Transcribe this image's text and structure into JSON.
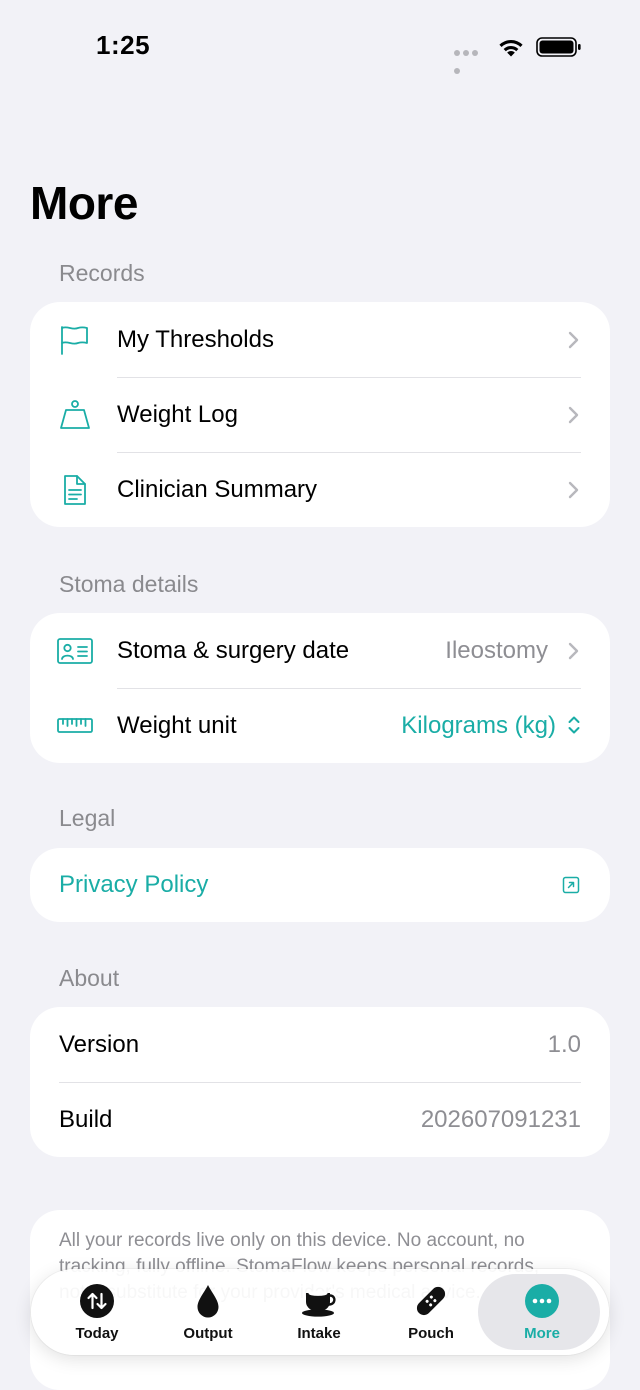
{
  "status_bar": {
    "time": "1:25"
  },
  "page": {
    "title": "More"
  },
  "sections": {
    "records": {
      "header": "Records",
      "items": [
        {
          "label": "My Thresholds",
          "icon": "flag-icon"
        },
        {
          "label": "Weight Log",
          "icon": "scale-icon"
        },
        {
          "label": "Clinician Summary",
          "icon": "document-icon"
        }
      ]
    },
    "stoma": {
      "header": "Stoma details",
      "items": [
        {
          "label": "Stoma & surgery date",
          "value": "Ileostomy",
          "icon": "id-card-icon"
        },
        {
          "label": "Weight unit",
          "value": "Kilograms (kg)",
          "icon": "ruler-icon"
        }
      ]
    },
    "legal": {
      "header": "Legal",
      "privacy_label": "Privacy Policy"
    },
    "about": {
      "header": "About",
      "items": [
        {
          "label": "Version",
          "value": "1.0"
        },
        {
          "label": "Build",
          "value": "202607091231"
        }
      ]
    }
  },
  "info": {
    "text": "All your records live only on this device. No account, no tracking, fully offline. StomaFlow keeps personal records, not a substitute for your provider's medical advice."
  },
  "tabbar": {
    "tabs": [
      {
        "label": "Today",
        "icon": "arrows-updown-icon"
      },
      {
        "label": "Output",
        "icon": "drop-icon"
      },
      {
        "label": "Intake",
        "icon": "cup-icon"
      },
      {
        "label": "Pouch",
        "icon": "bandage-icon"
      },
      {
        "label": "More",
        "icon": "ellipsis-icon",
        "active": true
      }
    ]
  },
  "colors": {
    "accent": "#1aada6",
    "background": "#f2f2f7",
    "secondary_text": "#8e8e93"
  }
}
